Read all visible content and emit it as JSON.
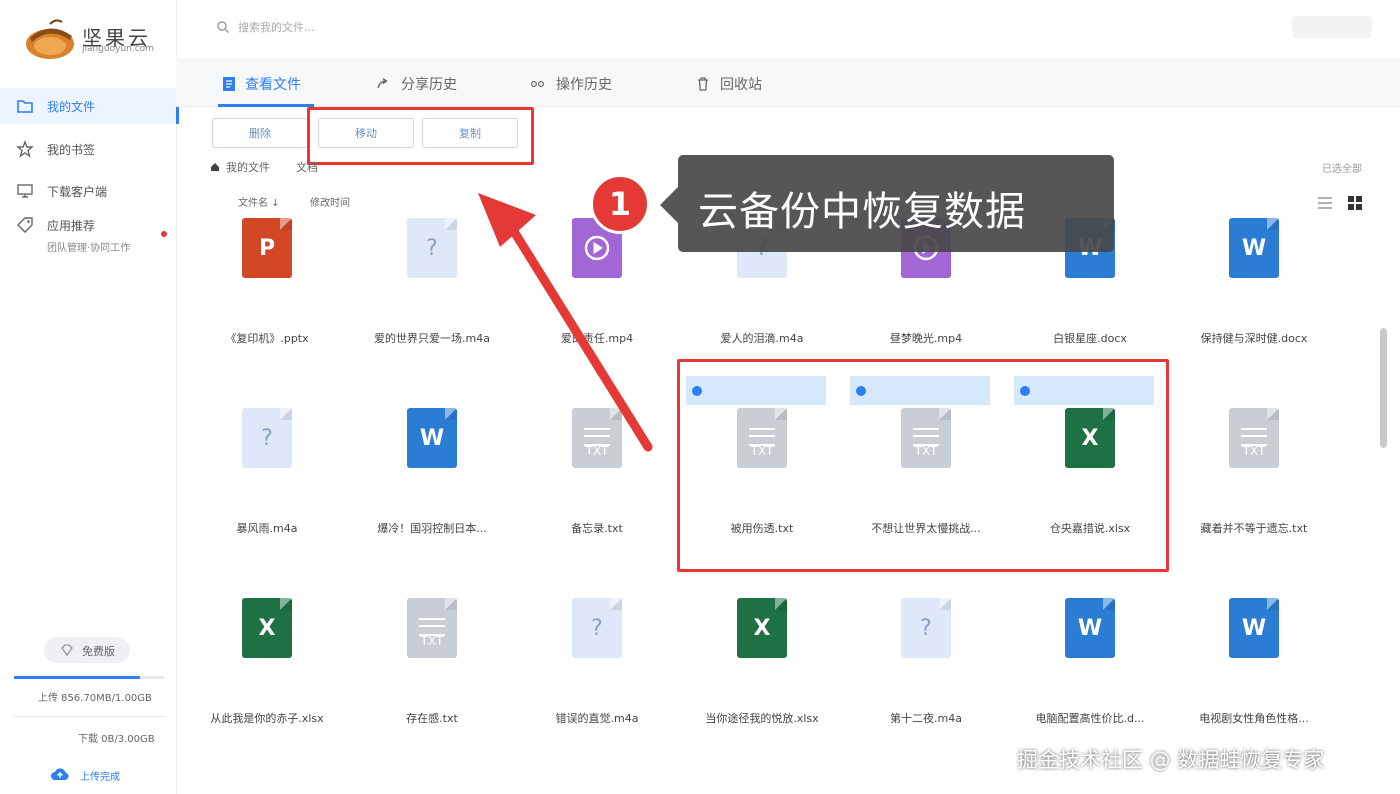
{
  "app": {
    "name": "坚果云",
    "subtitle": "jianguoyun.com"
  },
  "search": {
    "placeholder": "搜索我的文件..."
  },
  "sidebar": {
    "items": [
      {
        "label": "我的文件",
        "icon": "folder-icon",
        "active": true
      },
      {
        "label": "我的书签",
        "icon": "star-icon",
        "active": false
      },
      {
        "label": "下载客户端",
        "icon": "monitor-icon",
        "active": false
      },
      {
        "label": "应用推荐",
        "icon": "tag-icon",
        "active": false,
        "sub": "团队管理·协同工作"
      }
    ],
    "plan_label": "免费版",
    "upload_usage": "上传 856.70MB/1.00GB",
    "upload_fraction": 0.84,
    "download_usage": "下载 0B/3.00GB",
    "upload_status": "上传完成"
  },
  "tabs": [
    {
      "label": "查看文件",
      "icon": "file-icon",
      "active": true
    },
    {
      "label": "分享历史",
      "icon": "share-icon",
      "active": false
    },
    {
      "label": "操作历史",
      "icon": "history-icon",
      "active": false
    },
    {
      "label": "回收站",
      "icon": "trash-icon",
      "active": false
    }
  ],
  "toolbar": {
    "delete_label": "删除",
    "move_label": "移动",
    "copy_label": "复制"
  },
  "breadcrumb": {
    "root": "我的文件",
    "current": "文档"
  },
  "select_all": "已选全部",
  "sort": {
    "name": "文件名 ↓",
    "modified": "修改时间"
  },
  "annotation": {
    "step": "1",
    "text": "云备份中恢复数据"
  },
  "files": [
    {
      "name": "《复印机》.pptx",
      "type": "ppt",
      "selected": false
    },
    {
      "name": "爱的世界只爱一场.m4a",
      "type": "audio",
      "selected": false
    },
    {
      "name": "爱的责任.mp4",
      "type": "video",
      "selected": false
    },
    {
      "name": "爱人的泪滴.m4a",
      "type": "audio",
      "selected": false
    },
    {
      "name": "昼梦晚光.mp4",
      "type": "video",
      "selected": false
    },
    {
      "name": "白银星座.docx",
      "type": "word",
      "selected": false
    },
    {
      "name": "保持健与深时健.docx",
      "type": "word",
      "selected": false
    },
    {
      "name": "暴风雨.m4a",
      "type": "audio",
      "selected": false
    },
    {
      "name": "爆冷！国羽控制日本...",
      "type": "word",
      "selected": false
    },
    {
      "name": "备忘录.txt",
      "type": "text",
      "selected": false
    },
    {
      "name": "被用伤透.txt",
      "type": "text",
      "selected": true
    },
    {
      "name": "不想让世界太慢挑战...",
      "type": "text",
      "selected": true
    },
    {
      "name": "仓央嘉措说.xlsx",
      "type": "excel",
      "selected": true
    },
    {
      "name": "藏着并不等于遗忘.txt",
      "type": "text",
      "selected": false
    },
    {
      "name": "从此我是你的赤子.xlsx",
      "type": "excel",
      "selected": false
    },
    {
      "name": "存在感.txt",
      "type": "text",
      "selected": false
    },
    {
      "name": "错误的直觉.m4a",
      "type": "audio",
      "selected": false
    },
    {
      "name": "当你途径我的悦放.xlsx",
      "type": "excel",
      "selected": false
    },
    {
      "name": "第十二夜.m4a",
      "type": "audio",
      "selected": false
    },
    {
      "name": "电脑配置高性价比.d...",
      "type": "word",
      "selected": false
    },
    {
      "name": "电视剧女性角色性格...",
      "type": "word",
      "selected": false
    }
  ],
  "icon_glyphs": {
    "ppt": "P",
    "audio": "?",
    "word": "W",
    "excel": "X",
    "text": "TXT"
  },
  "watermark": "掘金技术社区 @ 数据蛙恢复专家",
  "colors": {
    "accent": "#2e7ef5",
    "highlight": "#e53935",
    "selection": "#d6e8fb"
  }
}
